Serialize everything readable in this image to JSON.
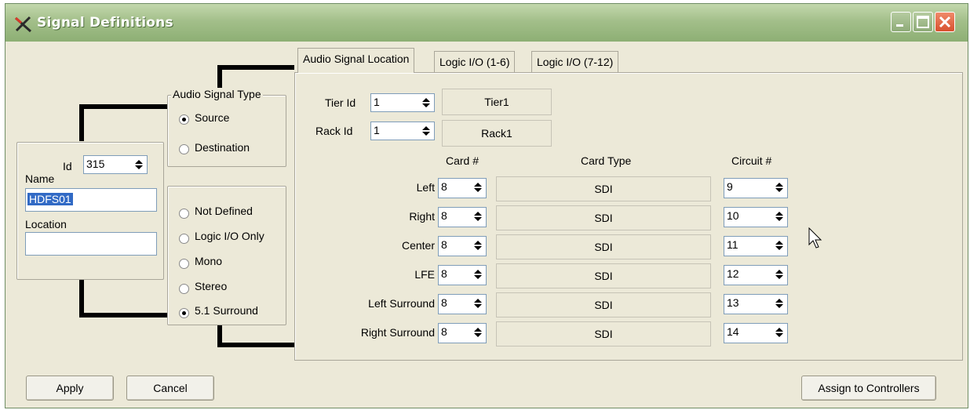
{
  "window": {
    "title": "Signal Definitions"
  },
  "signal": {
    "id_label": "Id",
    "id_value": "315",
    "name_label": "Name",
    "name_value": "HDFS01",
    "location_label": "Location",
    "location_value": ""
  },
  "audio_signal_type": {
    "legend": "Audio Signal Type",
    "options": [
      {
        "label": "Source",
        "selected": true
      },
      {
        "label": "Destination",
        "selected": false
      }
    ]
  },
  "format": {
    "options": [
      {
        "label": "Not Defined",
        "selected": false
      },
      {
        "label": "Logic I/O Only",
        "selected": false
      },
      {
        "label": "Mono",
        "selected": false
      },
      {
        "label": "Stereo",
        "selected": false
      },
      {
        "label": "5.1 Surround",
        "selected": true
      }
    ]
  },
  "tabs": [
    {
      "label": "Audio Signal Location",
      "active": true
    },
    {
      "label": "Logic I/O (1-6)",
      "active": false
    },
    {
      "label": "Logic I/O (7-12)",
      "active": false
    }
  ],
  "location": {
    "tier_label": "Tier Id",
    "tier_value": "1",
    "tier_name": "Tier1",
    "rack_label": "Rack Id",
    "rack_value": "1",
    "rack_name": "Rack1"
  },
  "channel_table": {
    "headers": {
      "card": "Card #",
      "card_type": "Card Type",
      "circuit": "Circuit #"
    },
    "rows": [
      {
        "channel": "Left",
        "card": "8",
        "card_type": "SDI",
        "circuit": "9"
      },
      {
        "channel": "Right",
        "card": "8",
        "card_type": "SDI",
        "circuit": "10"
      },
      {
        "channel": "Center",
        "card": "8",
        "card_type": "SDI",
        "circuit": "11"
      },
      {
        "channel": "LFE",
        "card": "8",
        "card_type": "SDI",
        "circuit": "12"
      },
      {
        "channel": "Left Surround",
        "card": "8",
        "card_type": "SDI",
        "circuit": "13"
      },
      {
        "channel": "Right Surround",
        "card": "8",
        "card_type": "SDI",
        "circuit": "14"
      }
    ]
  },
  "buttons": {
    "apply": "Apply",
    "cancel": "Cancel",
    "assign": "Assign to Controllers"
  },
  "colors": {
    "titlebar": "#a3bf8a",
    "window_bg": "#ece9d8",
    "close_button": "#d8502e"
  }
}
